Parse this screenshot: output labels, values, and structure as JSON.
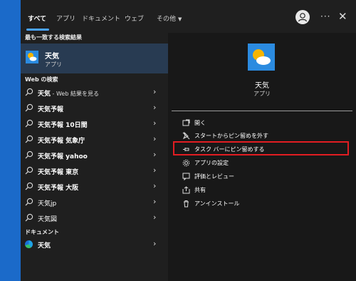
{
  "tabs": [
    {
      "label": "すべて"
    },
    {
      "label": "アプリ"
    },
    {
      "label": "ドキュメント"
    },
    {
      "label": "ウェブ"
    },
    {
      "label": "その他"
    }
  ],
  "best_match": {
    "heading": "最も一致する検索結果",
    "title": "天気",
    "subtitle": "アプリ"
  },
  "web": {
    "heading": "Web の検索",
    "items": [
      {
        "main": "天気",
        "suffix": " - Web 結果を見る"
      },
      {
        "main": "天気予報",
        "suffix": ""
      },
      {
        "main": "天気予報 10日間",
        "suffix": ""
      },
      {
        "main": "天気予報 気象庁",
        "suffix": ""
      },
      {
        "main": "天気予報 yahoo",
        "suffix": ""
      },
      {
        "main": "天気予報 東京",
        "suffix": ""
      },
      {
        "main": "天気予報 大阪",
        "suffix": ""
      },
      {
        "main": "天気jp",
        "suffix": ""
      },
      {
        "main": "天気図",
        "suffix": ""
      }
    ]
  },
  "documents": {
    "heading": "ドキュメント",
    "items": [
      {
        "label": "天気"
      }
    ]
  },
  "preview": {
    "app_name": "天気",
    "app_type": "アプリ",
    "actions": [
      {
        "label": "開く",
        "icon": "open-icon"
      },
      {
        "label": "スタートからピン留めを外す",
        "icon": "unpin-start-icon"
      },
      {
        "label": "タスク バーにピン留めする",
        "icon": "pin-taskbar-icon"
      },
      {
        "label": "アプリの設定",
        "icon": "gear-icon"
      },
      {
        "label": "評価とレビュー",
        "icon": "star-review-icon"
      },
      {
        "label": "共有",
        "icon": "share-icon"
      },
      {
        "label": "アンインストール",
        "icon": "trash-icon"
      }
    ]
  },
  "colors": {
    "accent": "#4aa3ff",
    "selection": "#283b52",
    "highlight_box": "#e11d22",
    "desktop": "#1b6ac9"
  }
}
